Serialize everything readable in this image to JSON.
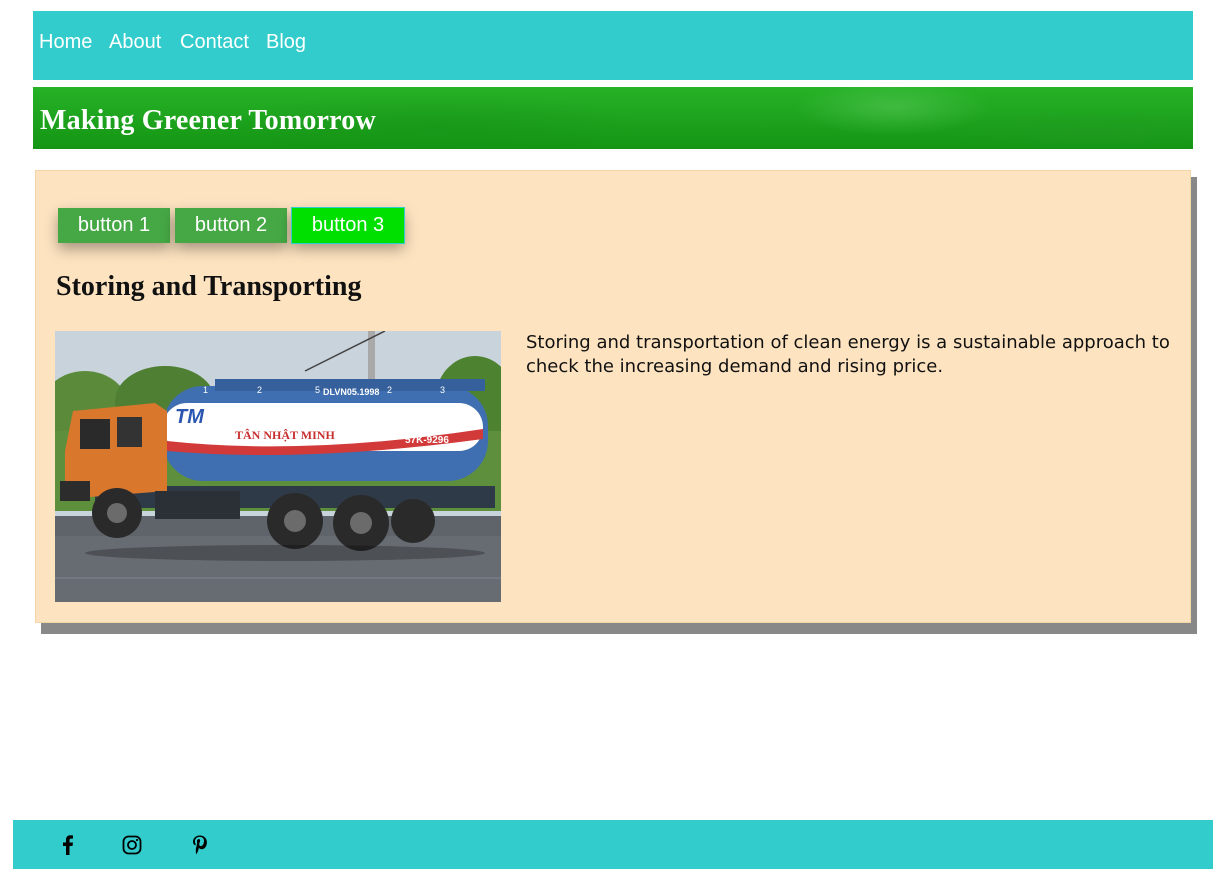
{
  "nav": {
    "items": [
      {
        "label": "Home"
      },
      {
        "label": "About"
      },
      {
        "label": "Contact"
      },
      {
        "label": "Blog"
      }
    ]
  },
  "banner": {
    "title": "Making Greener Tomorrow"
  },
  "tabs": [
    {
      "label": "button 1",
      "active": false
    },
    {
      "label": "button 2",
      "active": false
    },
    {
      "label": "button 3",
      "active": true
    }
  ],
  "section": {
    "title": "Storing and Transporting",
    "text": "Storing and transportation of clean energy is a sustainable approach to check the increasing demand and rising price.",
    "image": {
      "tank_brand": "TÂN NHẬT MINH",
      "tank_logo": "TM",
      "tank_code": "DLVN05.1998",
      "plate": "57K-9296",
      "compartments": [
        "1",
        "2",
        "5",
        "2",
        "3"
      ]
    }
  },
  "footer": {
    "icons": [
      "facebook-icon",
      "instagram-icon",
      "pinterest-icon"
    ]
  },
  "colors": {
    "nav_bg": "#33cccc",
    "card_bg": "#fde3c0",
    "tab_inactive": "#45a845",
    "tab_active": "#00e000",
    "banner_green": "#1fa51f"
  }
}
